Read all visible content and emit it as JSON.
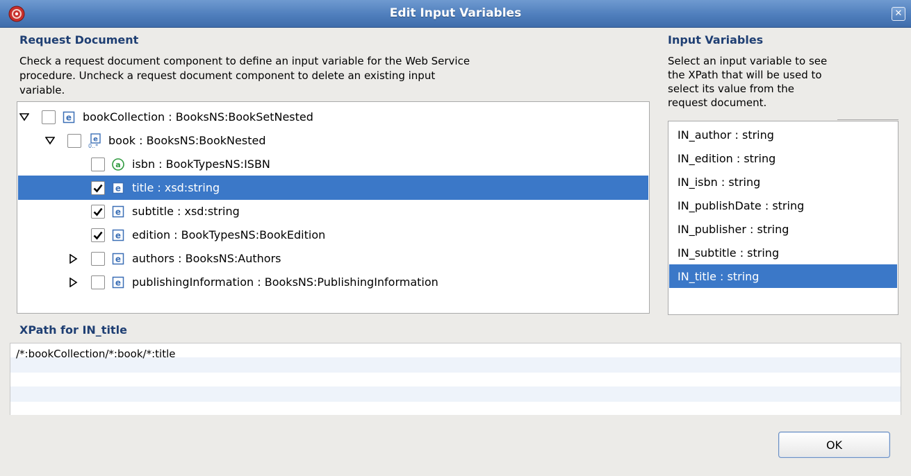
{
  "window": {
    "title": "Edit Input Variables"
  },
  "request_document": {
    "header": "Request Document",
    "description_lines": [
      "Check a request document component to define an input variable for the Web Service",
      "procedure.  Uncheck a request document component to delete an existing input",
      "variable."
    ],
    "tree": [
      {
        "label": "bookCollection : BooksNS:BookSetNested",
        "checked": false,
        "expanded": true,
        "icon": "element-icon"
      },
      {
        "label": "book : BooksNS:BookNested",
        "checked": false,
        "expanded": true,
        "icon": "repeating-element-icon"
      },
      {
        "label": "isbn : BookTypesNS:ISBN",
        "checked": false,
        "icon": "attribute-icon"
      },
      {
        "label": "title : xsd:string",
        "checked": true,
        "icon": "element-icon",
        "selected": true
      },
      {
        "label": "subtitle : xsd:string",
        "checked": true,
        "icon": "element-icon"
      },
      {
        "label": "edition : BookTypesNS:BookEdition",
        "checked": true,
        "icon": "element-icon"
      },
      {
        "label": "authors : BooksNS:Authors",
        "checked": false,
        "expanded": false,
        "icon": "element-icon"
      },
      {
        "label": "publishingInformation : BooksNS:PublishingInformation",
        "checked": false,
        "expanded": false,
        "icon": "element-icon"
      }
    ]
  },
  "input_variables": {
    "header": "Input Variables",
    "description_lines": [
      "Select an input variable to see",
      "the XPath that will be used to",
      "select its value from the",
      "request document."
    ],
    "items": [
      "IN_author : string",
      "IN_edition : string",
      "IN_isbn : string",
      "IN_publishDate : string",
      "IN_publisher : string",
      "IN_subtitle : string",
      "IN_title : string"
    ],
    "selected_index": 6
  },
  "xpath": {
    "header": "XPath for IN_title",
    "value": "/*:bookCollection/*:book/*:title"
  },
  "buttons": {
    "ok_label": "OK"
  },
  "colors": {
    "selection": "#3b78c8",
    "titlebar": "#4f7ebc",
    "header_text": "#1f3f73"
  }
}
